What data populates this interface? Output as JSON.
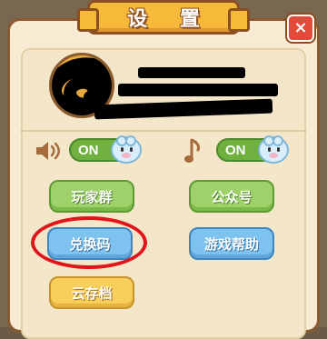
{
  "title": "设 置",
  "close_label": "×",
  "colors": {
    "panel_bg": "#f7ecd3",
    "title_bg": "#f7b93a",
    "green_button": "#9ed16a",
    "blue_button": "#7ec3f0",
    "yellow_button": "#f7cf5a",
    "toggle_on": "#6fb03f",
    "close_red": "#e34a3a",
    "highlight_red": "#e0141a"
  },
  "profile": {
    "avatar_icon": "avatar-icon",
    "name_redacted": true
  },
  "settings": {
    "sound": {
      "icon": "speaker-icon",
      "state": "ON"
    },
    "music": {
      "icon": "music-note-icon",
      "state": "ON"
    }
  },
  "buttons": {
    "player_group": "玩家群",
    "official_account": "公众号",
    "redeem_code": "兑换码",
    "game_help": "游戏帮助",
    "cloud_save": "云存档"
  }
}
